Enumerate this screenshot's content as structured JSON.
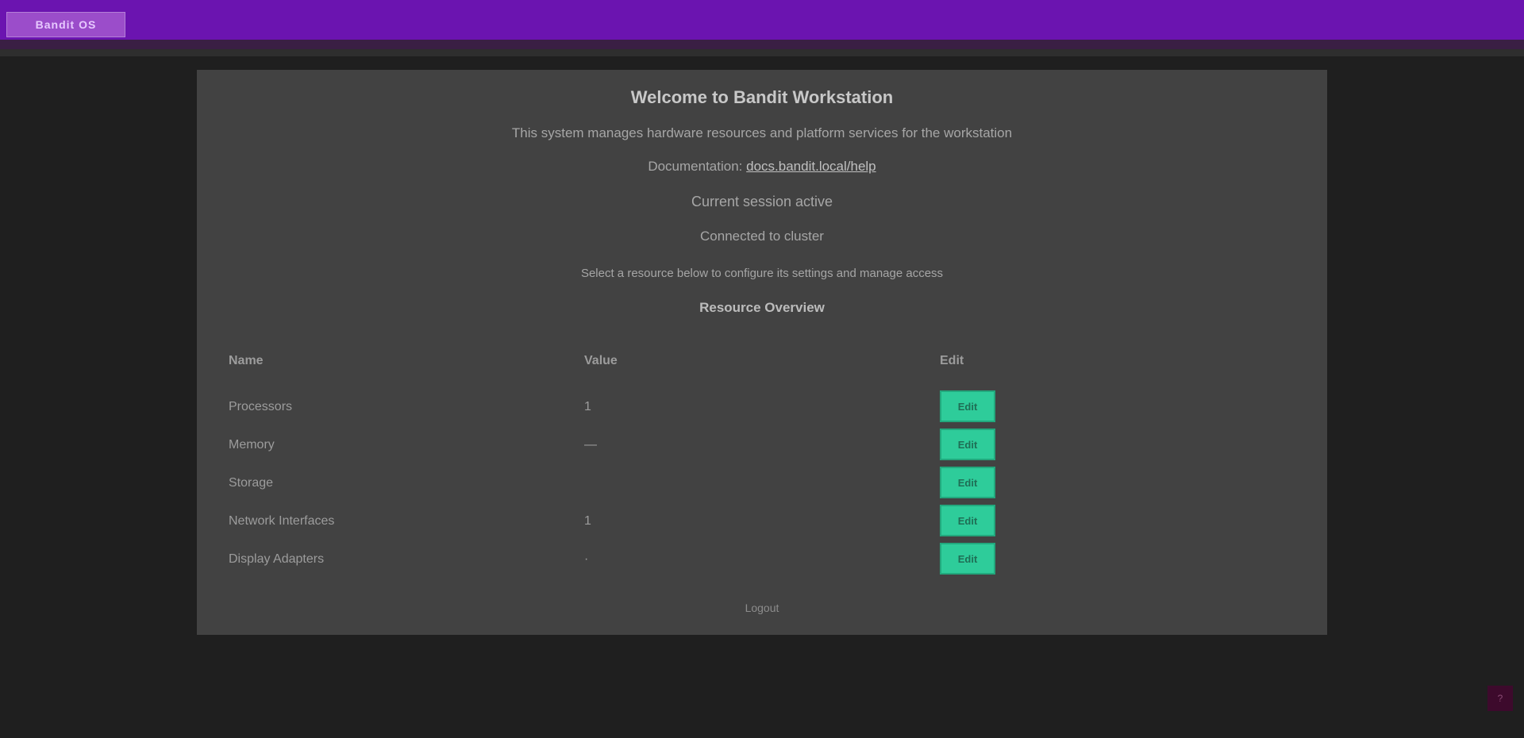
{
  "header": {
    "logo_text": "Bandit OS"
  },
  "main": {
    "heading": "Welcome to Bandit Workstation",
    "line1": "This system manages hardware resources and platform services for the workstation",
    "line2_prefix": "Documentation:",
    "line2_link": "docs.bandit.local/help",
    "line3": "Current session active",
    "line4": "Connected to cluster",
    "line5": "Select a resource below to configure its settings and manage access",
    "line6": "Resource Overview",
    "table": {
      "headers": [
        "Name",
        "Value",
        "Edit"
      ],
      "rows": [
        {
          "name": "Processors",
          "value": "1",
          "action": "Edit"
        },
        {
          "name": "Memory",
          "value": "—",
          "action": "Edit"
        },
        {
          "name": "Storage",
          "value": "",
          "action": "Edit"
        },
        {
          "name": "Network Interfaces",
          "value": "1",
          "action": "Edit"
        },
        {
          "name": "Display Adapters",
          "value": "·",
          "action": "Edit"
        }
      ]
    },
    "footer": "Logout"
  },
  "corner": {
    "label": "?"
  },
  "colors": {
    "topbar": "#6b14b0",
    "accent_button": "#2ecc9a",
    "panel": "#424242",
    "background": "#1f1f1f"
  }
}
